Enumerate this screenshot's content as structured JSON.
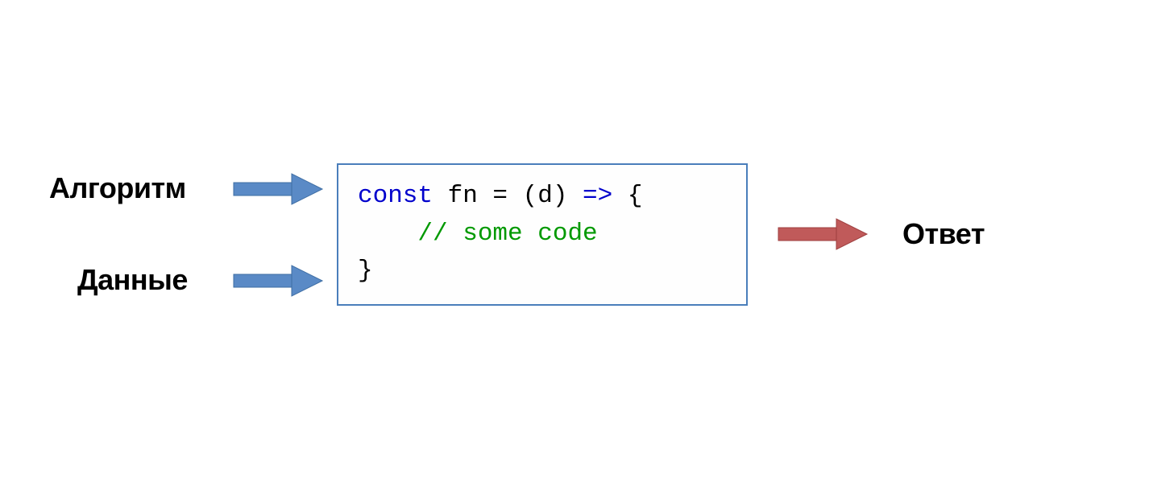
{
  "labels": {
    "input1": "Алгоритм",
    "input2": "Данные",
    "output": "Ответ"
  },
  "code": {
    "keyword1": "const",
    "mid": " fn = (d) ",
    "arrowop": "=>",
    "tail": " {",
    "comment_indent": "    ",
    "comment": "// some code",
    "close": "}"
  },
  "colors": {
    "arrow_blue": "#5a8ac6",
    "arrow_red": "#c05a5a",
    "box_border": "#4a7ebb",
    "keyword": "#0000cc",
    "comment": "#009900"
  }
}
